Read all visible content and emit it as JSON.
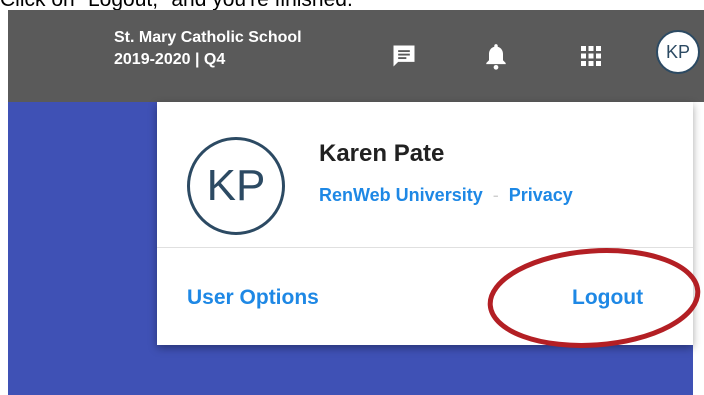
{
  "caption": "Click on \"Logout,\" and you're finished.",
  "header": {
    "school_name": "St. Mary Catholic School",
    "term": "2019-2020 | Q4",
    "icons": [
      "message-icon",
      "bell-icon",
      "apps-grid-icon"
    ],
    "avatar_initials": "KP",
    "bar_color": "#5a5a5a"
  },
  "profile_menu": {
    "avatar_initials": "KP",
    "user_name": "Karen Pate",
    "link_university": "RenWeb University",
    "link_separator": "-",
    "link_privacy": "Privacy",
    "user_options": "User Options",
    "logout": "Logout",
    "accent_color": "#1e88e5"
  },
  "annotation": {
    "highlight_target": "Logout",
    "color": "#b31f24"
  },
  "background_color": "#3f51b5"
}
